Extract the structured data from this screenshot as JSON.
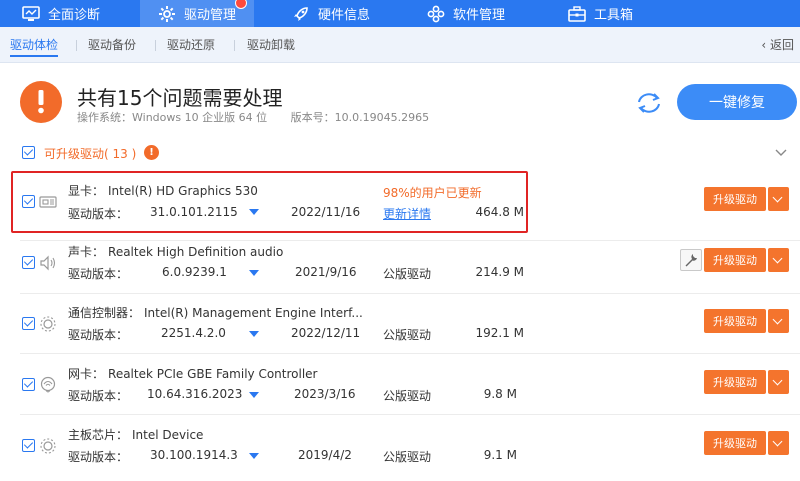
{
  "topnav": {
    "items": [
      {
        "label": "全面诊断",
        "icon": "monitor-icon"
      },
      {
        "label": "驱动管理",
        "icon": "gear-icon",
        "active": true
      },
      {
        "label": "硬件信息",
        "icon": "rocket-icon"
      },
      {
        "label": "软件管理",
        "icon": "apps-icon"
      },
      {
        "label": "工具箱",
        "icon": "toolbox-icon"
      }
    ],
    "accent": "#2a78f0"
  },
  "subnav": {
    "tabs": [
      {
        "label": "驱动体检",
        "active": true
      },
      {
        "label": "驱动备份"
      },
      {
        "label": "驱动还原"
      },
      {
        "label": "驱动卸载"
      }
    ],
    "back_label": "返回"
  },
  "header": {
    "title": "共有15个问题需要处理",
    "os_label": "操作系统：",
    "os_value": "Windows 10 企业版 64 位",
    "version_label": "版本号：",
    "version_value": "10.0.19045.2965",
    "fix_button": "一键修复"
  },
  "section": {
    "label": "可升级驱动( 13 )",
    "badge": "!"
  },
  "rows": [
    {
      "category": "显卡：",
      "name": "Intel(R) HD Graphics 530",
      "ver_label": "驱动版本：",
      "version": "31.0.101.2115",
      "date": "2022/11/16",
      "note": "98%的用户已更新",
      "status": "更新详情",
      "size": "464.8 M",
      "button": "升级驱动",
      "icon": "gpu-icon"
    },
    {
      "category": "声卡：",
      "name": "Realtek High Definition audio",
      "ver_label": "驱动版本：",
      "version": "6.0.9239.1",
      "date": "2021/9/16",
      "status": "公版驱动",
      "size": "214.9 M",
      "button": "升级驱动",
      "icon": "speaker-icon"
    },
    {
      "category": "通信控制器：",
      "name": "Intel(R) Management Engine Interf...",
      "ver_label": "驱动版本：",
      "version": "2251.4.2.0",
      "date": "2022/12/11",
      "status": "公版驱动",
      "size": "192.1 M",
      "button": "升级驱动",
      "icon": "chip-icon"
    },
    {
      "category": "网卡：",
      "name": "Realtek PCIe GBE Family Controller",
      "ver_label": "驱动版本：",
      "version": "10.64.316.2023",
      "date": "2023/3/16",
      "status": "公版驱动",
      "size": "9.8 M",
      "button": "升级驱动",
      "icon": "network-icon"
    },
    {
      "category": "主板芯片：",
      "name": "Intel Device",
      "ver_label": "驱动版本：",
      "version": "30.100.1914.3",
      "date": "2019/4/2",
      "status": "公版驱动",
      "size": "9.1 M",
      "button": "升级驱动",
      "icon": "chip-icon"
    }
  ]
}
